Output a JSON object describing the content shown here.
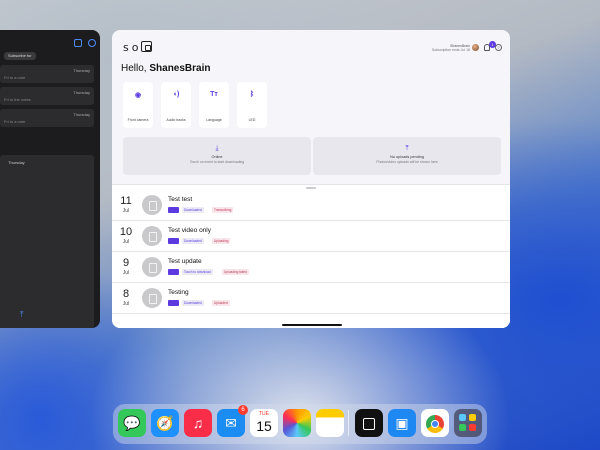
{
  "left_app": {
    "chip": "Subscribe for",
    "rows": [
      {
        "day": "Thursday",
        "text": "Fri to a note"
      },
      {
        "day": "Thursday",
        "text": "Fri to the notes"
      },
      {
        "day": "Thursday",
        "text": "Fri to a note"
      }
    ],
    "panel_day": "Thursday"
  },
  "main": {
    "logo_left": "so",
    "user": {
      "name": "ShanesBrain",
      "subtitle": "Subscription ends Jul 18"
    },
    "notification_count": "1",
    "help_glyph": "?",
    "greeting": "Hello,",
    "username": "ShanesBrain",
    "tiles": [
      {
        "label": "Front camera",
        "icon": "camera-icon",
        "glyph": "◉"
      },
      {
        "label": "Audio tracks",
        "icon": "audio-icon",
        "glyph": "◖)"
      },
      {
        "label": "Language",
        "icon": "text-icon",
        "glyph": "Tт"
      },
      {
        "label": "LED",
        "icon": "bluetooth-icon",
        "glyph": "ᛒ"
      }
    ],
    "panels": [
      {
        "icon": "download-icon",
        "glyph": "⤓",
        "title": "Online",
        "subtitle": "Touch on event to start downloading"
      },
      {
        "icon": "upload-icon",
        "glyph": "⤒",
        "title": "No uploads pending",
        "subtitle": "Photos/video uploads will be shown here"
      }
    ],
    "entries": [
      {
        "day": "11",
        "month": "Jul",
        "title": "Test test",
        "tag2": "Downloaded",
        "tag3": "Transcribing"
      },
      {
        "day": "10",
        "month": "Jul",
        "title": "Test video only",
        "tag2": "Downloaded",
        "tag3": "Uploading"
      },
      {
        "day": "9",
        "month": "Jul",
        "title": "Test update",
        "tag2": "Touch to download",
        "tag3": "Uploading failed"
      },
      {
        "day": "8",
        "month": "Jul",
        "title": "Testing",
        "tag2": "Downloaded",
        "tag3": "Uploaded"
      }
    ]
  },
  "dock": {
    "calendar_day": "TUE",
    "calendar_date": "15",
    "mail_badge": "6",
    "apps": [
      "Messages",
      "Safari",
      "Music",
      "Mail",
      "Calendar",
      "Photos",
      "Notes",
      "Solo",
      "Files",
      "Chrome",
      "App Library"
    ]
  }
}
